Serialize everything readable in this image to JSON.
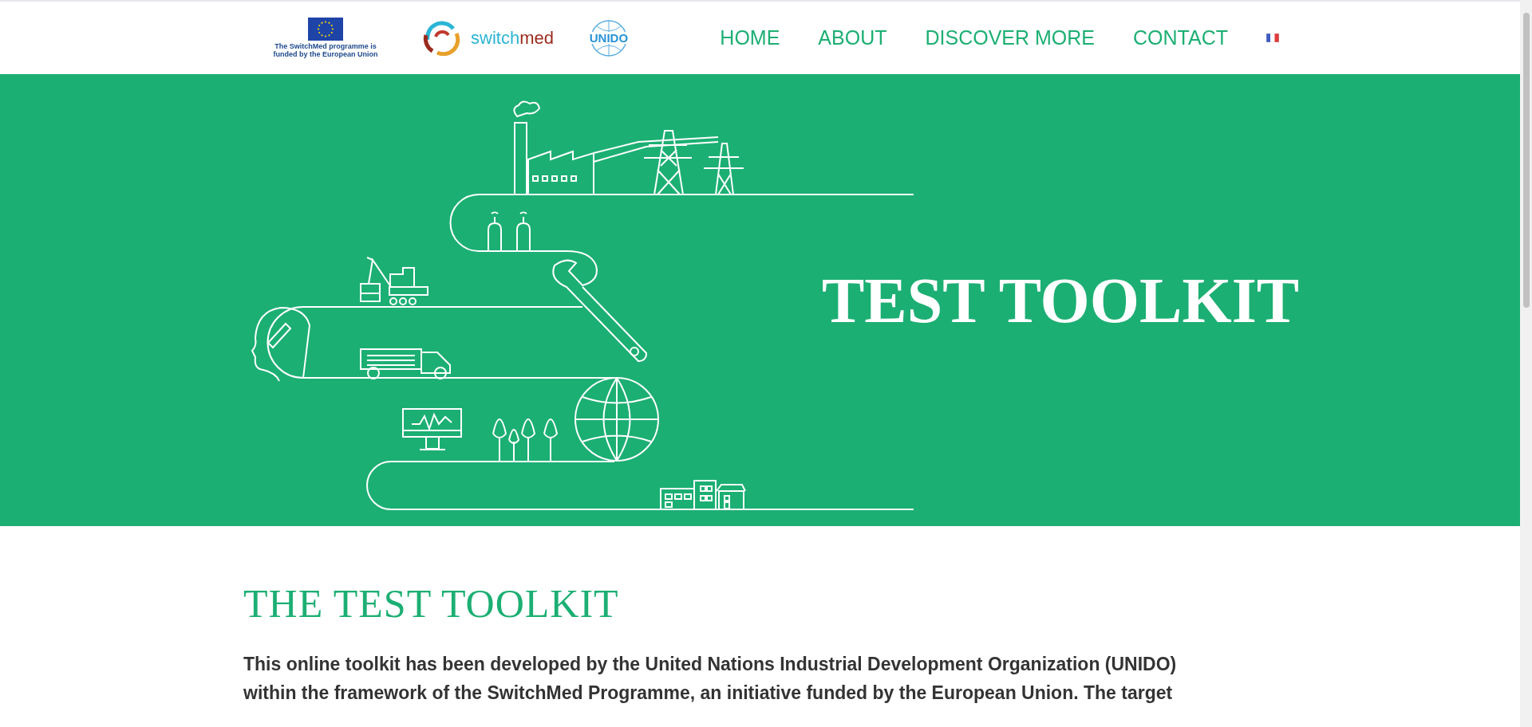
{
  "header": {
    "eu_caption_lines": [
      "The SwitchMed programme is",
      "funded by the European Union"
    ],
    "switchmed_logo": {
      "part_1": "switch",
      "part_2": "med"
    },
    "unido_logo": "UNIDO",
    "nav": [
      {
        "label": "HOME"
      },
      {
        "label": "ABOUT"
      },
      {
        "label": "DISCOVER MORE"
      },
      {
        "label": "CONTACT"
      }
    ]
  },
  "hero": {
    "title": "TEST TOOLKIT"
  },
  "section": {
    "heading": "THE TEST TOOLKIT",
    "paragraph_lines": [
      "This online toolkit has been developed by the United Nations Industrial Development Organization (UNIDO)",
      "within the framework of the SwitchMed Programme, an initiative funded by the European Union. The target"
    ]
  }
}
